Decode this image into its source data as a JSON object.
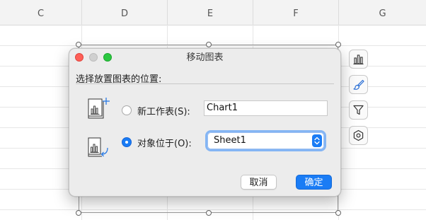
{
  "spreadsheet": {
    "columns": [
      "C",
      "D",
      "E",
      "F",
      "G"
    ]
  },
  "dialog": {
    "title": "移动图表",
    "heading": "选择放置图表的位置:",
    "options": [
      {
        "label": "新工作表(S):",
        "selected": false,
        "value": "Chart1"
      },
      {
        "label": "对象位于(O):",
        "selected": true,
        "value": "Sheet1"
      }
    ],
    "buttons": {
      "cancel": "取消",
      "ok": "确定"
    }
  },
  "side_tools": [
    {
      "name": "chart-elements",
      "icon": "bar-chart-icon"
    },
    {
      "name": "chart-styles",
      "icon": "brush-icon"
    },
    {
      "name": "chart-filters",
      "icon": "filter-icon"
    },
    {
      "name": "chart-settings",
      "icon": "hexagon-settings-icon"
    }
  ],
  "colors": {
    "accent": "#1a7cf5",
    "close": "#fe5f57",
    "maximize": "#2bc840"
  }
}
